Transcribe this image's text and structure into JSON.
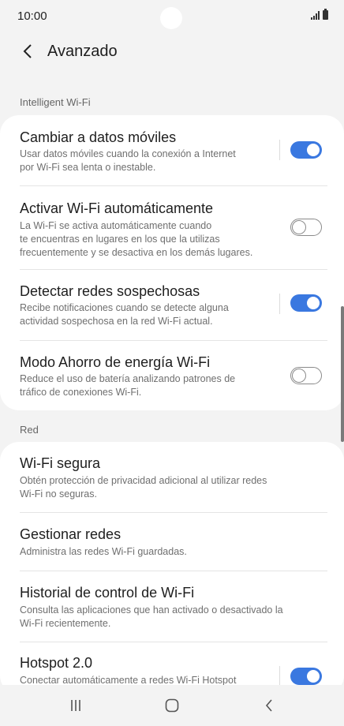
{
  "status_bar": {
    "time": "10:00"
  },
  "header": {
    "title": "Avanzado"
  },
  "sections": {
    "intelligent": {
      "label": "Intelligent Wi-Fi"
    },
    "red": {
      "label": "Red"
    }
  },
  "intelligent_items": [
    {
      "title": "Cambiar a datos móviles",
      "subtitle": "Usar datos móviles cuando la conexión a Internet\npor Wi-Fi sea lenta o inestable.",
      "toggle": true
    },
    {
      "title": "Activar Wi-Fi automáticamente",
      "subtitle": "La Wi-Fi se activa automáticamente cuando\nte encuentras en lugares en los que la utilizas\nfrecuentemente y se desactiva en los demás lugares.",
      "toggle": false
    },
    {
      "title": "Detectar redes sospechosas",
      "subtitle": "Recibe notificaciones cuando se detecte alguna\nactividad sospechosa en la red Wi-Fi actual.",
      "toggle": true
    },
    {
      "title": "Modo Ahorro de energía Wi-Fi",
      "subtitle": "Reduce el uso de batería analizando patrones de\ntráfico de conexiones Wi-Fi.",
      "toggle": false
    }
  ],
  "red_items": [
    {
      "title": "Wi-Fi segura",
      "subtitle": "Obtén protección de privacidad adicional al utilizar redes\nWi-Fi no seguras."
    },
    {
      "title": "Gestionar redes",
      "subtitle": "Administra las redes Wi-Fi guardadas."
    },
    {
      "title": "Historial de control de Wi-Fi",
      "subtitle": "Consulta las aplicaciones que han activado o desactivado la\nWi-Fi recientemente."
    },
    {
      "title": "Hotspot 2.0",
      "subtitle": "Conectar automáticamente a redes Wi-Fi Hotspot",
      "toggle": true
    }
  ],
  "colors": {
    "accent": "#3a78e0",
    "background": "#f3f3f3",
    "card": "#ffffff"
  },
  "icons": {
    "back": "chevron-left-icon",
    "nav_recents": "recents-icon",
    "nav_home": "home-icon",
    "nav_back": "back-icon"
  }
}
